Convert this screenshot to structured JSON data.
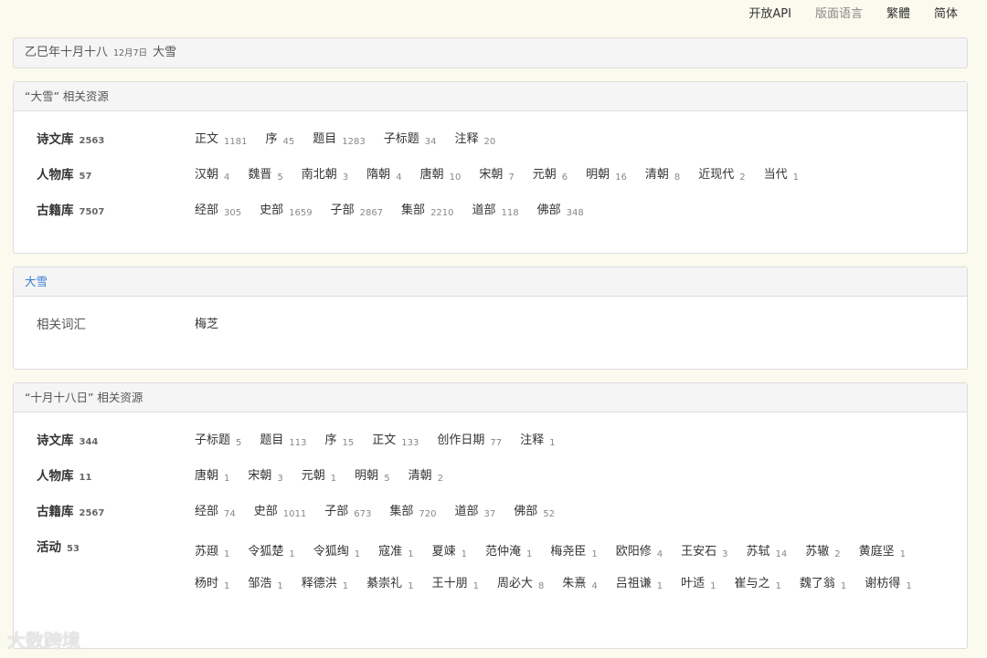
{
  "topnav": [
    "开放API",
    "版面语言",
    "繁體",
    "简体"
  ],
  "date": {
    "lunar": "乙巳年十月十八",
    "solar": "12月7日",
    "term": "大雪"
  },
  "panel1": {
    "heading": "“大雪” 相关资源",
    "rows": [
      {
        "label": "诗文库",
        "count": "2563",
        "items": [
          [
            "正文",
            "1181"
          ],
          [
            "序",
            "45"
          ],
          [
            "题目",
            "1283"
          ],
          [
            "子标题",
            "34"
          ],
          [
            "注释",
            "20"
          ]
        ]
      },
      {
        "label": "人物库",
        "count": "57",
        "items": [
          [
            "汉朝",
            "4"
          ],
          [
            "魏晋",
            "5"
          ],
          [
            "南北朝",
            "3"
          ],
          [
            "隋朝",
            "4"
          ],
          [
            "唐朝",
            "10"
          ],
          [
            "宋朝",
            "7"
          ],
          [
            "元朝",
            "6"
          ],
          [
            "明朝",
            "16"
          ],
          [
            "清朝",
            "8"
          ],
          [
            "近现代",
            "2"
          ],
          [
            "当代",
            "1"
          ]
        ]
      },
      {
        "label": "古籍库",
        "count": "7507",
        "items": [
          [
            "经部",
            "305"
          ],
          [
            "史部",
            "1659"
          ],
          [
            "子部",
            "2867"
          ],
          [
            "集部",
            "2210"
          ],
          [
            "道部",
            "118"
          ],
          [
            "佛部",
            "348"
          ]
        ]
      }
    ]
  },
  "panel2": {
    "heading": "大雪",
    "label": "相关词汇",
    "value": "梅芝"
  },
  "panel3": {
    "heading": "“十月十八日” 相关资源",
    "rows": [
      {
        "label": "诗文库",
        "count": "344",
        "items": [
          [
            "子标题",
            "5"
          ],
          [
            "题目",
            "113"
          ],
          [
            "序",
            "15"
          ],
          [
            "正文",
            "133"
          ],
          [
            "创作日期",
            "77"
          ],
          [
            "注释",
            "1"
          ]
        ]
      },
      {
        "label": "人物库",
        "count": "11",
        "items": [
          [
            "唐朝",
            "1"
          ],
          [
            "宋朝",
            "3"
          ],
          [
            "元朝",
            "1"
          ],
          [
            "明朝",
            "5"
          ],
          [
            "清朝",
            "2"
          ]
        ]
      },
      {
        "label": "古籍库",
        "count": "2567",
        "items": [
          [
            "经部",
            "74"
          ],
          [
            "史部",
            "1011"
          ],
          [
            "子部",
            "673"
          ],
          [
            "集部",
            "720"
          ],
          [
            "道部",
            "37"
          ],
          [
            "佛部",
            "52"
          ]
        ]
      },
      {
        "label": "活动",
        "count": "53",
        "items": [
          [
            "苏颋",
            "1"
          ],
          [
            "令狐楚",
            "1"
          ],
          [
            "令狐绹",
            "1"
          ],
          [
            "寇准",
            "1"
          ],
          [
            "夏竦",
            "1"
          ],
          [
            "范仲淹",
            "1"
          ],
          [
            "梅尧臣",
            "1"
          ],
          [
            "欧阳修",
            "4"
          ],
          [
            "王安石",
            "3"
          ],
          [
            "苏轼",
            "14"
          ],
          [
            "苏辙",
            "2"
          ],
          [
            "黄庭坚",
            "1"
          ],
          [
            "杨时",
            "1"
          ],
          [
            "邹浩",
            "1"
          ],
          [
            "释德洪",
            "1"
          ],
          [
            "綦崇礼",
            "1"
          ],
          [
            "王十朋",
            "1"
          ],
          [
            "周必大",
            "8"
          ],
          [
            "朱熹",
            "4"
          ],
          [
            "吕祖谦",
            "1"
          ],
          [
            "叶适",
            "1"
          ],
          [
            "崔与之",
            "1"
          ],
          [
            "魏了翁",
            "1"
          ],
          [
            "谢枋得",
            "1"
          ]
        ]
      }
    ]
  },
  "watermark": "大数跨境"
}
